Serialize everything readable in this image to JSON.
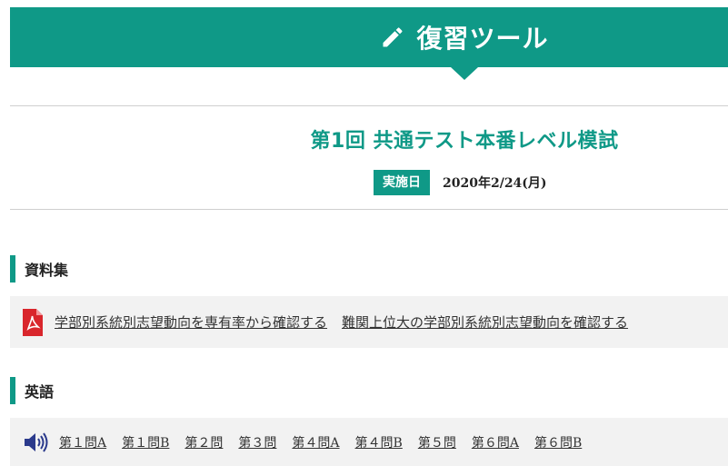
{
  "header": {
    "title": "復習ツール",
    "icon": "pencil-icon"
  },
  "exam": {
    "title": "第1回 共通テスト本番レベル模試",
    "date_label": "実施日",
    "date_value": "2020年2/24(月)"
  },
  "materials": {
    "heading": "資料集",
    "icon": "pdf-icon",
    "links": [
      "学部別系統別志望動向を専有率から確認する",
      "難関上位大の学部別系統別志望動向を確認する"
    ]
  },
  "english": {
    "heading": "英語",
    "icon": "speaker-icon",
    "links": [
      "第１問A",
      "第１問B",
      "第２問",
      "第３問",
      "第４問A",
      "第４問B",
      "第５問",
      "第６問A",
      "第６問B"
    ]
  },
  "colors": {
    "accent": "#0f9987",
    "pdf_red": "#d9262c",
    "speaker_blue": "#2b3a8c"
  }
}
